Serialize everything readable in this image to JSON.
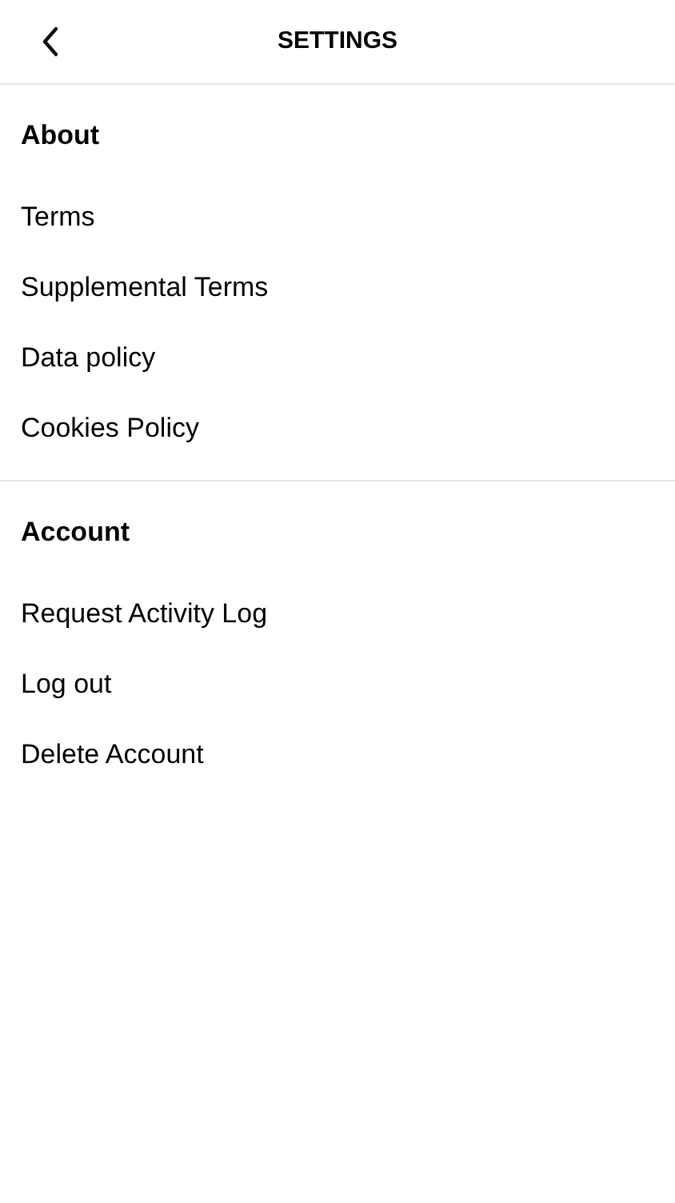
{
  "header": {
    "title": "SETTINGS"
  },
  "sections": [
    {
      "heading": "About",
      "items": [
        {
          "label": "Terms"
        },
        {
          "label": "Supplemental Terms"
        },
        {
          "label": "Data policy"
        },
        {
          "label": "Cookies Policy"
        }
      ]
    },
    {
      "heading": "Account",
      "items": [
        {
          "label": "Request Activity Log"
        },
        {
          "label": "Log out"
        },
        {
          "label": "Delete Account"
        }
      ]
    }
  ]
}
